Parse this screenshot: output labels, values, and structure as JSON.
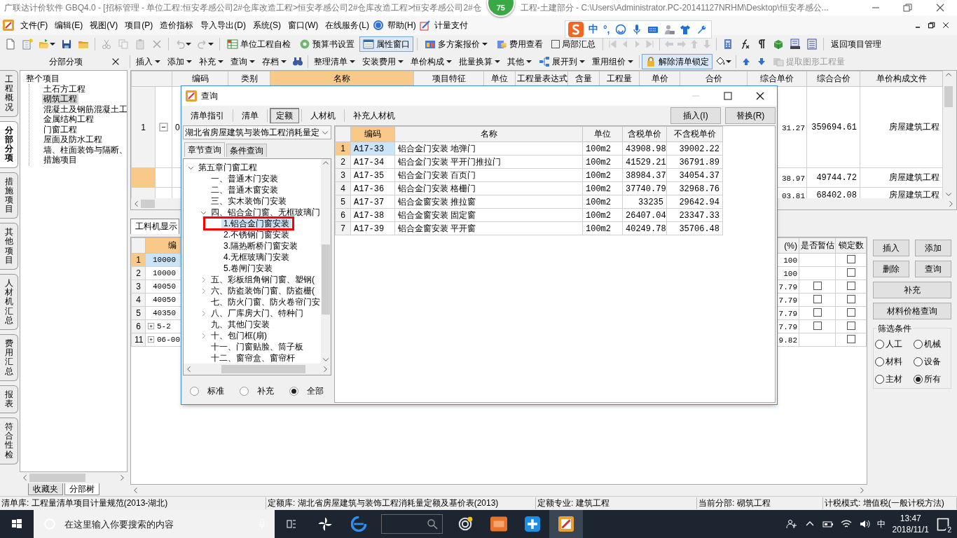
{
  "title_bar": {
    "title_start": "广联达计价软件 GBQ4.0 - [招标管理 - 单位工程:恒安孝感公司2#仓库改造工程>恒安孝感公司2#仓库改造工程>恒安孝感公司2#仓",
    "badge": "75",
    "title_end": "工程-土建部分 - C:\\Users\\Administrator.PC-20141127NRHM\\Desktop\\恒安孝感公..."
  },
  "menu_bar": {
    "items": [
      "文件(F)",
      "编辑(E)",
      "视图(V)",
      "项目(P)",
      "造价指标",
      "导入导出(D)",
      "系统(S)",
      "窗口(W)",
      "在线服务(L)",
      "帮助(H)",
      "计量支付"
    ]
  },
  "ime_bar": {
    "items": [
      "中",
      "°,"
    ]
  },
  "toolbar_1": {
    "buttons": [
      {
        "label": "单位工程自检",
        "selected": false
      },
      {
        "label": "预算书设置",
        "selected": false
      },
      {
        "label": "属性窗口",
        "selected": true
      },
      {
        "label": "多方案报价",
        "selected": false
      },
      {
        "label": "费用查看",
        "selected": false
      }
    ],
    "checkbox": {
      "label": "局部汇总",
      "checked": false
    },
    "link": "返回项目管理"
  },
  "panel": {
    "title": "分部分项"
  },
  "toolbar_2": {
    "items": [
      {
        "label": "插入",
        "dropdown": true,
        "selected": false,
        "disabled": false
      },
      {
        "label": "添加",
        "dropdown": true,
        "selected": false,
        "disabled": false
      },
      {
        "label": "补充",
        "dropdown": true,
        "selected": false,
        "disabled": false
      },
      {
        "label": "查询",
        "dropdown": true,
        "selected": false,
        "disabled": false
      },
      {
        "label": "存档",
        "dropdown": true,
        "selected": false,
        "disabled": false
      },
      {
        "label": "整理清单",
        "dropdown": true,
        "selected": false,
        "disabled": false
      },
      {
        "label": "安装费用",
        "dropdown": true,
        "selected": false,
        "disabled": false
      },
      {
        "label": "单价构成",
        "dropdown": true,
        "selected": false,
        "disabled": false
      },
      {
        "label": "批量换算",
        "dropdown": true,
        "selected": false,
        "disabled": false
      },
      {
        "label": "其他",
        "dropdown": true,
        "selected": false,
        "disabled": false
      },
      {
        "label": "展开到",
        "dropdown": true,
        "selected": false,
        "disabled": false
      },
      {
        "label": "重用组价",
        "dropdown": true,
        "selected": false,
        "disabled": false
      },
      {
        "label": "解除清单锁定",
        "dropdown": false,
        "selected": true,
        "disabled": false
      },
      {
        "label": "提取图形工程量",
        "dropdown": false,
        "selected": false,
        "disabled": true
      }
    ]
  },
  "side_tabs": [
    {
      "label": "工程概况",
      "selected": false
    },
    {
      "label": "分部分项",
      "selected": true
    },
    {
      "label": "措施项目",
      "selected": false
    },
    {
      "label": "其他项目",
      "selected": false
    },
    {
      "label": "人材机汇总",
      "selected": false
    },
    {
      "label": "费用汇总",
      "selected": false
    },
    {
      "label": "报表",
      "selected": false
    },
    {
      "label": "符合性检",
      "selected": false
    }
  ],
  "project_tree": {
    "label": "整个项目",
    "children": [
      {
        "label": "土石方工程",
        "selected": false
      },
      {
        "label": "砌筑工程",
        "selected": true
      },
      {
        "label": "混凝土及钢筋混凝土工",
        "selected": false
      },
      {
        "label": "金属结构工程",
        "selected": false
      },
      {
        "label": "门窗工程",
        "selected": false
      },
      {
        "label": "屋面及防水工程",
        "selected": false
      },
      {
        "label": "墙、柱面装饰与隔断、",
        "selected": false
      },
      {
        "label": "措施项目",
        "selected": false
      }
    ]
  },
  "tree_tabs": [
    {
      "label": "收藏夹",
      "selected": false
    },
    {
      "label": "分部树",
      "selected": true
    }
  ],
  "item_grid": {
    "columns": [
      "编码",
      "类别",
      "名称",
      "项目特征",
      "单位",
      "工程量表达式",
      "含量",
      "工程量",
      "单价",
      "合价",
      "综合单价",
      "综合合价",
      "单价构成文件"
    ],
    "rows": [
      {
        "number": "1",
        "selected": false,
        "code": "0",
        "expanded": true,
        "unit_price": "31.27",
        "total": "359694.61",
        "file": "房屋建筑工程"
      },
      {
        "selected": true,
        "unit_price": "38.97",
        "total": "49744.72",
        "file": "房屋建筑工程"
      },
      {
        "selected": false,
        "unit_price": "03.81",
        "total": "68402.08",
        "file": "房屋建筑工程"
      }
    ]
  },
  "resource_grid": {
    "tab": "工料机显示",
    "columns": [
      "编",
      "(%)",
      "是否暂估",
      "锁定数"
    ],
    "rows": [
      {
        "number": "1",
        "selected": true,
        "code": "10000",
        "pct": "100",
        "lock_checked": false
      },
      {
        "number": "2",
        "selected": false,
        "code": "10000",
        "pct": "100",
        "lock_checked": false
      },
      {
        "number": "3",
        "selected": false,
        "code": "40050",
        "pct": "7.79",
        "estimate_checked": false,
        "lock_checked": false
      },
      {
        "number": "4",
        "selected": false,
        "code": "40050",
        "pct": "7.79",
        "estimate_checked": false,
        "lock_checked": false
      },
      {
        "number": "5",
        "selected": false,
        "code": "40350",
        "pct": "7.79",
        "estimate_checked": false,
        "lock_checked": false
      },
      {
        "number": "6",
        "selected": false,
        "code": "5-2",
        "expanded": false,
        "pct": "7.79",
        "estimate_checked": false,
        "lock_checked": false
      },
      {
        "number": "11",
        "selected": false,
        "code": "06-00",
        "expanded": false,
        "pct": "9.82",
        "lock_checked": false
      }
    ]
  },
  "side_panel": {
    "buttons": [
      "插入",
      "添加",
      "删除",
      "查询",
      "补充",
      "材料价格查询"
    ],
    "filter": {
      "title": "筛选条件",
      "options": [
        {
          "label": "人工",
          "selected": false
        },
        {
          "label": "机械",
          "selected": false
        },
        {
          "label": "材料",
          "selected": false
        },
        {
          "label": "设备",
          "selected": false
        },
        {
          "label": "主材",
          "selected": false
        },
        {
          "label": "所有",
          "selected": true
        }
      ]
    }
  },
  "dialog": {
    "title": "查询",
    "tabs": [
      {
        "label": "清单指引",
        "selected": false
      },
      {
        "label": "清单",
        "selected": false
      },
      {
        "label": "定额",
        "selected": true
      },
      {
        "label": "人材机",
        "selected": false
      },
      {
        "label": "补充人材机",
        "selected": false
      }
    ],
    "buttons": [
      "插入(I)",
      "替换(R)"
    ],
    "library": "湖北省房屋建筑与装饰工程消耗量定",
    "subtabs": [
      {
        "label": "章节查询",
        "selected": true
      },
      {
        "label": "条件查询",
        "selected": false
      }
    ],
    "tree": {
      "label": "第五章门窗工程",
      "expanded": true,
      "selected": false,
      "children": [
        {
          "label": "一、普通木门安装",
          "selected": false
        },
        {
          "label": "二、普通木窗安装",
          "selected": false
        },
        {
          "label": "三、实木装饰门安装",
          "selected": false
        },
        {
          "label": "四、铝合金门窗、无框玻璃门",
          "expanded": true,
          "selected": false,
          "children": [
            {
              "label": "1.铝合金门窗安装",
              "selected": true,
              "highlighted": true
            },
            {
              "label": "2.不锈钢门窗安装",
              "selected": false
            },
            {
              "label": "3.隔热断桥门窗安装",
              "selected": false
            },
            {
              "label": "4.无框玻璃门安装",
              "selected": false
            },
            {
              "label": "5.卷闸门安装",
              "selected": false
            }
          ]
        },
        {
          "label": "五、彩板组角钢门窗、塑钢(",
          "expanded": false,
          "selected": false
        },
        {
          "label": "六、防盗装饰门窗、防盗栅(",
          "expanded": false,
          "selected": false
        },
        {
          "label": "七、防火门窗、防火卷帘门安",
          "selected": false
        },
        {
          "label": "八、厂库房大门、特种门",
          "expanded": false,
          "selected": false
        },
        {
          "label": "九、其他门安装",
          "selected": false
        },
        {
          "label": "十、包门框(扇)",
          "expanded": false,
          "selected": false
        },
        {
          "label": "十一、门窗贴脸、筒子板",
          "selected": false
        },
        {
          "label": "十二、窗帘盒、窗帘杆",
          "selected": false
        }
      ]
    },
    "scope": [
      {
        "label": "标准",
        "selected": false
      },
      {
        "label": "补充",
        "selected": false
      },
      {
        "label": "全部",
        "selected": true
      }
    ],
    "table": {
      "columns": [
        "编码",
        "名称",
        "单位",
        "含税单价",
        "不含税单价"
      ],
      "rows": [
        {
          "number": "1",
          "selected": true,
          "code": "A17-33",
          "name": "铝合金门安装 地弹门",
          "unit": "100m2",
          "price_tax": "43908.98",
          "price_net": "39002.22"
        },
        {
          "number": "2",
          "selected": false,
          "code": "A17-34",
          "name": "铝合金门安装 平开门推拉门",
          "unit": "100m2",
          "price_tax": "41529.21",
          "price_net": "36791.89"
        },
        {
          "number": "3",
          "selected": false,
          "code": "A17-35",
          "name": "铝合金门安装 百页门",
          "unit": "100m2",
          "price_tax": "38984.37",
          "price_net": "34054.37"
        },
        {
          "number": "4",
          "selected": false,
          "code": "A17-36",
          "name": "铝合金门安装 格栅门",
          "unit": "100m2",
          "price_tax": "37740.79",
          "price_net": "32968.76"
        },
        {
          "number": "5",
          "selected": false,
          "code": "A17-37",
          "name": "铝合金窗安装 推拉窗",
          "unit": "100m2",
          "price_tax": "33235",
          "price_net": "29642.94"
        },
        {
          "number": "6",
          "selected": false,
          "code": "A17-38",
          "name": "铝合金窗安装 固定窗",
          "unit": "100m2",
          "price_tax": "26407.04",
          "price_net": "23347.33"
        },
        {
          "number": "7",
          "selected": false,
          "code": "A17-39",
          "name": "铝合金窗安装 平开窗",
          "unit": "100m2",
          "price_tax": "40249.78",
          "price_net": "35706.48"
        }
      ]
    }
  },
  "status_bar": [
    "清单库: 工程量清单项目计量规范(2013-湖北)",
    "定额库: 湖北省房屋建筑与装饰工程消耗量定额及基价表(2013)",
    "定额专业: 建筑工程",
    "当前分部: 砌筑工程",
    "计税模式: 增值税(一般计税方法)"
  ],
  "taskbar": {
    "search": {
      "placeholder": "在这里输入你要搜索的内容"
    },
    "ime": "中",
    "time": "13:47",
    "date": "2018/11/1",
    "notifications": "2"
  }
}
